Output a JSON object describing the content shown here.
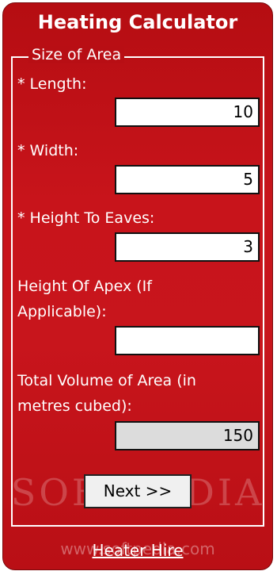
{
  "title": "Heating Calculator",
  "section": {
    "legend": "Size of Area"
  },
  "fields": {
    "length": {
      "label": "* Length:",
      "value": "10"
    },
    "width": {
      "label": "* Width:",
      "value": "5"
    },
    "height_eaves": {
      "label": "* Height To Eaves:",
      "value": "3"
    },
    "height_apex": {
      "label_line1": "Height Of Apex (If",
      "label_line2": "Applicable):",
      "value": ""
    },
    "total_volume": {
      "label_line1": "Total Volume of Area (in",
      "label_line2": "metres cubed):",
      "value": "150"
    }
  },
  "buttons": {
    "next": "Next >>"
  },
  "footer": {
    "link": "Heater Hire"
  },
  "watermark": {
    "text": "SOFTPEDIA",
    "url": "www.softpedia.com"
  },
  "colors": {
    "panel": "#c8141b",
    "text": "#ffffff",
    "readonly_field": "#dcdcdc"
  }
}
